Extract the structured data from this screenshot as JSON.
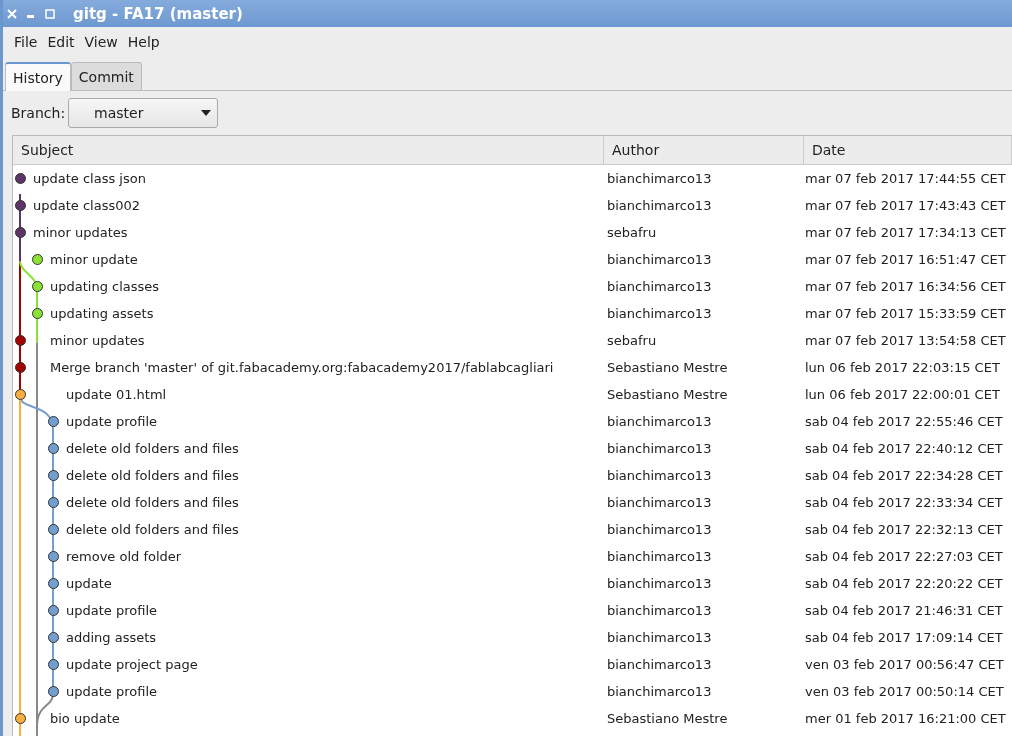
{
  "window": {
    "title": "gitg - FA17 (master)"
  },
  "menu": [
    "File",
    "Edit",
    "View",
    "Help"
  ],
  "tabs": [
    {
      "label": "History",
      "selected": true
    },
    {
      "label": "Commit",
      "selected": false
    }
  ],
  "branch": {
    "label": "Branch:",
    "value": "master"
  },
  "table": {
    "columns": [
      "Subject",
      "Author",
      "Date"
    ],
    "rows": [
      {
        "subject": "update class json",
        "author": "bianchimarco13",
        "date": "mar 07 feb 2017 17:44:55 CET",
        "color": "#5c3566"
      },
      {
        "subject": "update class002",
        "author": "bianchimarco13",
        "date": "mar 07 feb 2017 17:43:43 CET",
        "color": "#5c3566"
      },
      {
        "subject": "minor updates",
        "author": "sebafru",
        "date": "mar 07 feb 2017 17:34:13 CET",
        "color": "#5c3566"
      },
      {
        "subject": "minor update",
        "author": "bianchimarco13",
        "date": "mar 07 feb 2017 16:51:47 CET",
        "color": "#8ae234"
      },
      {
        "subject": "updating classes",
        "author": "bianchimarco13",
        "date": "mar 07 feb 2017 16:34:56 CET",
        "color": "#8ae234"
      },
      {
        "subject": "updating assets",
        "author": "bianchimarco13",
        "date": "mar 07 feb 2017 15:33:59 CET",
        "color": "#8ae234"
      },
      {
        "subject": "minor updates",
        "author": "sebafru",
        "date": "mar 07 feb 2017 13:54:58 CET",
        "color": "#a40000"
      },
      {
        "subject": "Merge branch 'master' of git.fabacademy.org:fabacademy2017/fablabcagliari",
        "author": "Sebastiano Mestre",
        "date": "lun 06 feb 2017 22:03:15 CET",
        "color": "#a40000"
      },
      {
        "subject": "update 01.html",
        "author": "Sebastiano Mestre",
        "date": "lun 06 feb 2017 22:00:01 CET",
        "color": "#fcaf3e"
      },
      {
        "subject": "update profile",
        "author": "bianchimarco13",
        "date": "sab 04 feb 2017 22:55:46 CET",
        "color": "#729fcf"
      },
      {
        "subject": "delete old folders and files",
        "author": "bianchimarco13",
        "date": "sab 04 feb 2017 22:40:12 CET",
        "color": "#729fcf"
      },
      {
        "subject": "delete old folders and files",
        "author": "bianchimarco13",
        "date": "sab 04 feb 2017 22:34:28 CET",
        "color": "#729fcf"
      },
      {
        "subject": "delete old folders and files",
        "author": "bianchimarco13",
        "date": "sab 04 feb 2017 22:33:34 CET",
        "color": "#729fcf"
      },
      {
        "subject": "delete old folders and files",
        "author": "bianchimarco13",
        "date": "sab 04 feb 2017 22:32:13 CET",
        "color": "#729fcf"
      },
      {
        "subject": "remove old folder",
        "author": "bianchimarco13",
        "date": "sab 04 feb 2017 22:27:03 CET",
        "color": "#729fcf"
      },
      {
        "subject": "update",
        "author": "bianchimarco13",
        "date": "sab 04 feb 2017 22:20:22 CET",
        "color": "#729fcf"
      },
      {
        "subject": "update profile",
        "author": "bianchimarco13",
        "date": "sab 04 feb 2017 21:46:31 CET",
        "color": "#729fcf"
      },
      {
        "subject": "adding assets",
        "author": "bianchimarco13",
        "date": "sab 04 feb 2017 17:09:14 CET",
        "color": "#729fcf"
      },
      {
        "subject": "update project page",
        "author": "bianchimarco13",
        "date": "ven 03 feb 2017 00:56:47 CET",
        "color": "#729fcf"
      },
      {
        "subject": "update profile",
        "author": "bianchimarco13",
        "date": "ven 03 feb 2017 00:50:14 CET",
        "color": "#729fcf"
      },
      {
        "subject": "bio update",
        "author": "Sebastiano Mestre",
        "date": "mer 01 feb 2017 16:21:00 CET",
        "color": "#fcaf3e"
      }
    ]
  }
}
